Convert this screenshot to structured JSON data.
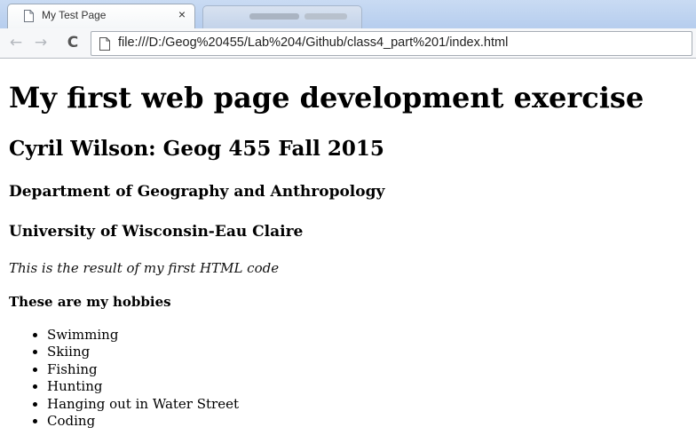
{
  "browser": {
    "tab_title": "My Test Page",
    "tab_close": "×",
    "url": "file:///D:/Geog%20455/Lab%204/Github/class4_part%201/index.html",
    "nav": {
      "back": "←",
      "forward": "→",
      "reload": "C"
    }
  },
  "page": {
    "h1": "My first web page development exercise",
    "h2": "Cyril Wilson: Geog 455 Fall 2015",
    "h3_department": "Department of Geography and Anthropology",
    "h3_university": "University of Wisconsin-Eau Claire",
    "italic_note": "This is the result of my first HTML code",
    "hobbies_title": "These are my hobbies",
    "hobbies": [
      "Swimming",
      "Skiing",
      "Fishing",
      "Hunting",
      "Hanging out in Water Street",
      "Coding"
    ]
  }
}
